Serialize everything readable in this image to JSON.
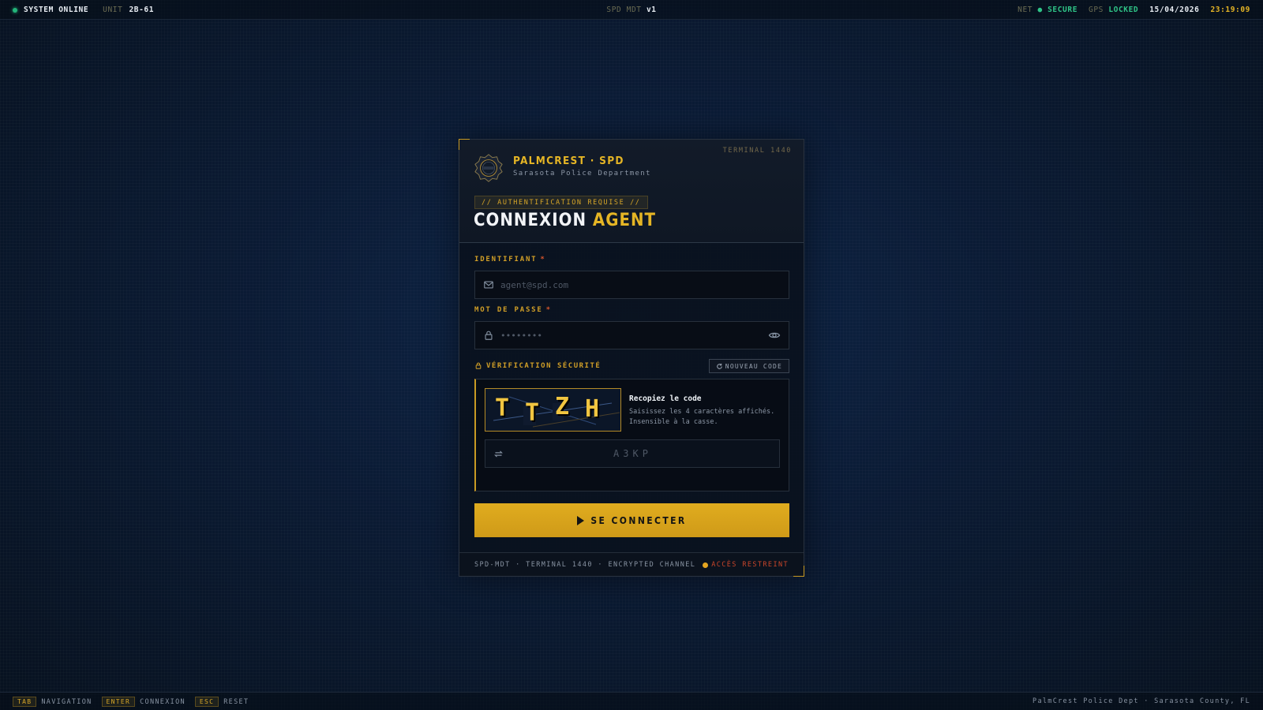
{
  "topbar": {
    "status": "SYSTEM ONLINE",
    "unit_label": "UNIT",
    "unit_value": "2B-61",
    "app_label": "SPD MDT",
    "app_version": "v1",
    "net_label": "NET",
    "net_value": "● SECURE",
    "gps_label": "GPS",
    "gps_value": "LOCKED",
    "date": "15/04/2026",
    "time": "23:19:09"
  },
  "card": {
    "terminal": "TERMINAL 1440",
    "brand_title": "PALMCREST · SPD",
    "brand_subtitle": "Sarasota Police Department",
    "auth_tag": "// AUTHENTIFICATION REQUISE //",
    "title_main": "CONNEXION",
    "title_accent": "AGENT",
    "identifiant_label": "IDENTIFIANT",
    "identifiant_required": "*",
    "identifiant_placeholder": "agent@spd.com",
    "password_label": "MOT DE PASSE",
    "password_required": "*",
    "password_placeholder": "••••••••",
    "security_label": "VÉRIFICATION SÉCURITÉ",
    "new_code_button": "NOUVEAU CODE",
    "captcha_chars": [
      "T",
      "T",
      "Z",
      "H"
    ],
    "captcha_title": "Recopiez le code",
    "captcha_desc": "Saisissez les 4 caractères affichés. Insensible à la casse.",
    "captcha_placeholder": "A3KP",
    "submit_label": "SE CONNECTER",
    "footer_left": "SPD-MDT · TERMINAL 1440 · ENCRYPTED CHANNEL",
    "footer_right": "ACCÈS RESTREINT"
  },
  "bottombar": {
    "shortcuts": [
      {
        "key": "TAB",
        "label": "NAVIGATION"
      },
      {
        "key": "ENTER",
        "label": "CONNEXION"
      },
      {
        "key": "ESC",
        "label": "RESET"
      }
    ],
    "right": "PalmCrest Police Dept · Sarasota County, FL"
  },
  "icons": {
    "status": "status-dot",
    "badge": "police-badge-icon",
    "email": "mail-icon",
    "password": "lock-icon",
    "toggle_password": "eye-icon",
    "security": "lock-icon",
    "new_code": "refresh-icon",
    "captcha_input": "swap-icon",
    "submit": "play-icon",
    "restricted": "status-dot"
  },
  "colors": {
    "accent": "#e5b525",
    "online": "#23b47a",
    "restricted": "#c9452a",
    "background": "#0a1a33"
  }
}
